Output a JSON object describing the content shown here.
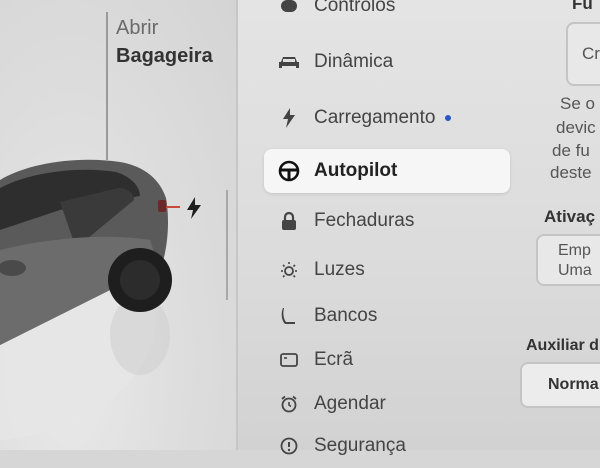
{
  "left_panel": {
    "trunk": {
      "action": "Abrir",
      "object": "Bagageira"
    },
    "charge_port_icon": "lightning-icon"
  },
  "menu": {
    "items": [
      {
        "label": "Controlos",
        "icon": "car-toggle-icon"
      },
      {
        "label": "Dinâmica",
        "icon": "car-icon"
      },
      {
        "label": "Carregamento",
        "icon": "lightning-icon",
        "indicator": "blue-dot"
      },
      {
        "label": "Autopilot",
        "icon": "steering-wheel-icon",
        "selected": true
      },
      {
        "label": "Fechaduras",
        "icon": "lock-icon"
      },
      {
        "label": "Luzes",
        "icon": "sun-icon"
      },
      {
        "label": "Bancos",
        "icon": "seat-icon"
      },
      {
        "label": "Ecrã",
        "icon": "display-icon"
      },
      {
        "label": "Agendar",
        "icon": "alarm-clock-icon"
      },
      {
        "label": "Segurança",
        "icon": "info-icon"
      }
    ]
  },
  "right_panel": {
    "header": "Fu",
    "button_partial": "Cr",
    "desc_lines": [
      "Se o",
      "devic",
      "de fu",
      "deste"
    ],
    "activation_title": "Ativaç",
    "activation_option_lines": [
      "Emp",
      "Uma"
    ],
    "assist_title": "Auxiliar d",
    "assist_value": "Norma"
  },
  "colors": {
    "indicator_blue": "#2a56c6",
    "charge_red": "#c94a3a"
  }
}
